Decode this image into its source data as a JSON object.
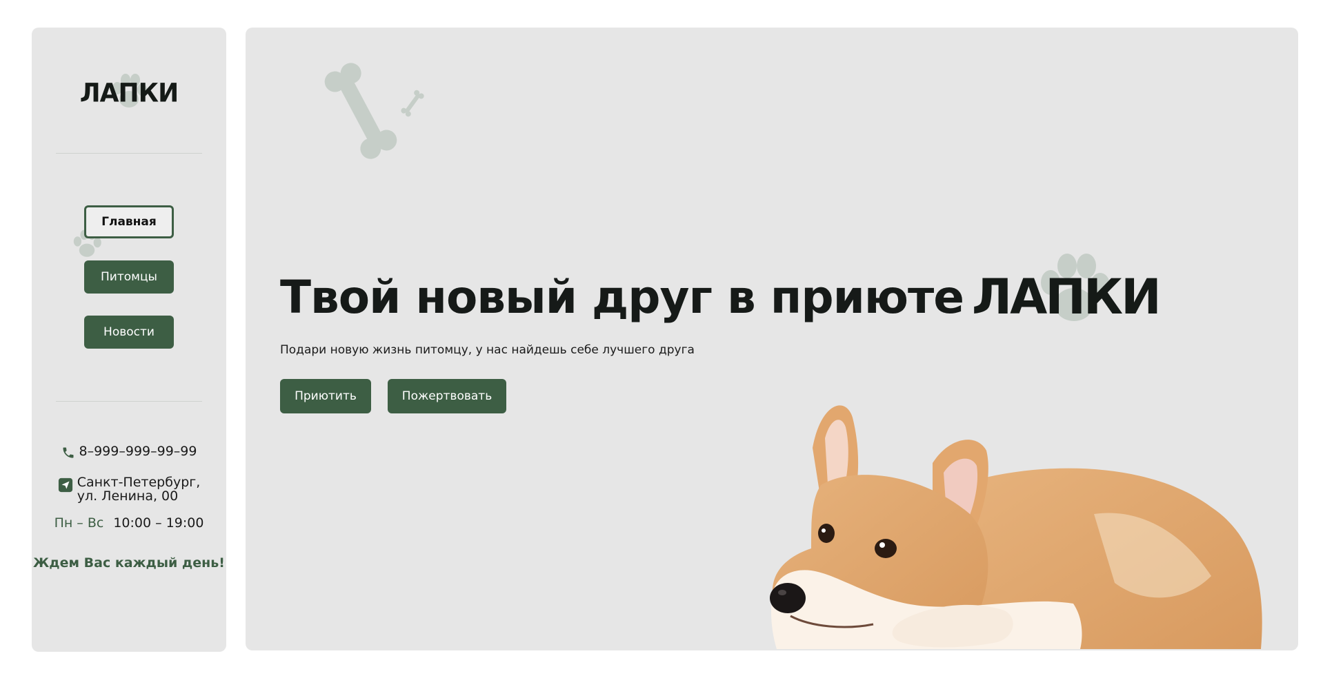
{
  "brand": {
    "logo_text": "ЛАПКИ"
  },
  "sidebar": {
    "nav": [
      {
        "label": "Главная",
        "active": true
      },
      {
        "label": "Питомцы",
        "active": false
      },
      {
        "label": "Новости",
        "active": false
      }
    ],
    "contacts": {
      "phone": "8–999–999–99–99",
      "address_line1": "Санкт-Петербург,",
      "address_line2": "ул. Ленина, 00",
      "hours_days": "Пн – Вс",
      "hours_time": "10:00 – 19:00"
    },
    "welcome": "Ждем Вас каждый день!"
  },
  "hero": {
    "title": "Твой новый друг в приюте",
    "brand": "ЛАПКИ",
    "subtitle": "Подари новую жизнь питомцу, у нас найдешь себе лучшего друга",
    "buttons": {
      "adopt": "Приютить",
      "donate": "Пожертвовать"
    }
  },
  "icons": {
    "phone": "phone-icon",
    "location": "location-icon",
    "paw": "paw-icon",
    "bone": "bone-icon"
  },
  "colors": {
    "accent": "#3d5e44",
    "panel": "#e6e6e6",
    "paw": "#c6cec8",
    "text": "#161a18"
  }
}
